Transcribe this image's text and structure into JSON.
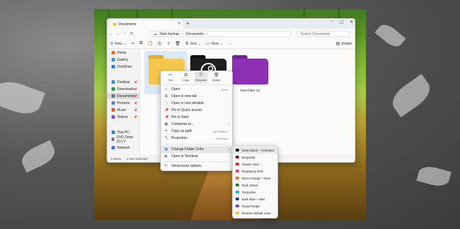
{
  "window": {
    "tab_title": "Documents",
    "breadcrumb": [
      "Start backup",
      "Documents"
    ],
    "search_placeholder": "Search Documents",
    "toolbar": {
      "new": "New",
      "sort": "Sort",
      "view": "View",
      "details": "Details"
    }
  },
  "sidebar": {
    "items": [
      {
        "label": "Home",
        "color": "#e96f3b"
      },
      {
        "label": "Gallery",
        "color": "#3b8fd9"
      },
      {
        "label": "OneDrive",
        "color": "#2b7cd3"
      },
      {
        "label": "Desktop",
        "color": "#3b8fd9"
      },
      {
        "label": "Downloads",
        "color": "#2f9a55"
      },
      {
        "label": "Documents",
        "color": "#6d7a8a"
      },
      {
        "label": "Pictures",
        "color": "#4a8ed8"
      },
      {
        "label": "Music",
        "color": "#e05a3a"
      },
      {
        "label": "Videos",
        "color": "#8a4fc4"
      },
      {
        "label": "This PC",
        "color": "#3f7fc4"
      },
      {
        "label": "DVD Drive (D:) V",
        "color": "#777777"
      },
      {
        "label": "Network",
        "color": "#3f7fc4"
      }
    ]
  },
  "folders": [
    {
      "name": "",
      "color": "#f5c74c"
    },
    {
      "name": "",
      "color": "#1e1e1e"
    },
    {
      "name": "New folder (2)",
      "color": "#8b2fb4"
    }
  ],
  "status": {
    "count": "3 items",
    "selected": "1 item selected"
  },
  "context_menu": {
    "quick": [
      "Cut",
      "Copy",
      "Rename",
      "Delete"
    ],
    "items": [
      {
        "label": "Open",
        "shortcut": "Enter"
      },
      {
        "label": "Open in new tab",
        "shortcut": ""
      },
      {
        "label": "Open in new window",
        "shortcut": ""
      },
      {
        "label": "Pin to Quick access",
        "shortcut": ""
      },
      {
        "label": "Pin to Start",
        "shortcut": ""
      },
      {
        "label": "Compress to...",
        "shortcut": ""
      },
      {
        "label": "Copy as path",
        "shortcut": "Ctrl+Shift+C"
      },
      {
        "label": "Properties",
        "shortcut": "Alt+Enter"
      },
      {
        "label": "Change Folder Color",
        "shortcut": ""
      },
      {
        "label": "Open in Terminal",
        "shortcut": ""
      },
      {
        "label": "Show more options",
        "shortcut": ""
      }
    ]
  },
  "color_submenu": [
    {
      "label": "Deep Black + Checked",
      "color": "#1b1b1b"
    },
    {
      "label": "Burgundy",
      "color": "#7b1f3a"
    },
    {
      "label": "Classic Red",
      "color": "#d42a2a"
    },
    {
      "label": "Raspberry Red",
      "color": "#e0457b"
    },
    {
      "label": "Burnt Orange + New",
      "color": "#e0702a"
    },
    {
      "label": "Dark Green",
      "color": "#2f7a3a"
    },
    {
      "label": "Turquoise",
      "color": "#23b3c4"
    },
    {
      "label": "Dark Blue + Wet",
      "color": "#1f3f9a"
    },
    {
      "label": "Royal Purple",
      "color": "#7b3fb8"
    },
    {
      "label": "Restore default color",
      "color": "#f3c34a"
    }
  ]
}
